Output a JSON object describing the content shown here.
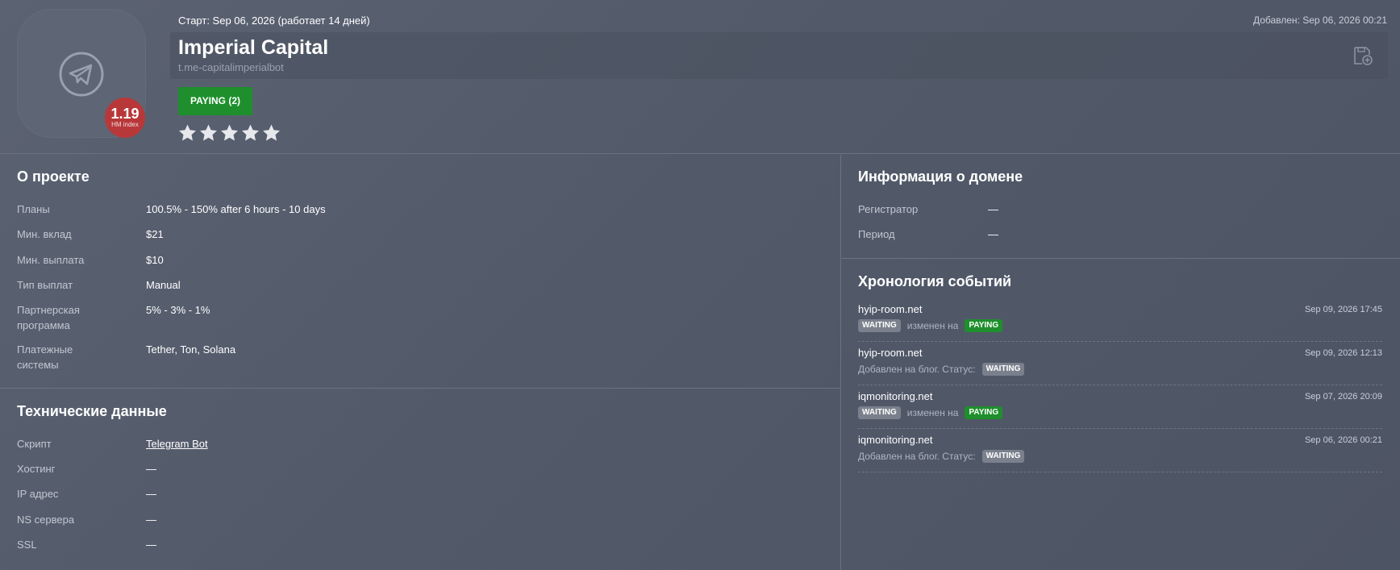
{
  "header": {
    "start_text": "Старт: Sep 06, 2026 (работает 14 дней)",
    "added_text": "Добавлен: Sep 06, 2026 00:21",
    "title": "Imperial Capital",
    "url": "t.me-capitalimperialbot",
    "status_label": "PAYING (2)",
    "hm_index_value": "1.19",
    "hm_index_label": "HM index",
    "rating_stars": 5,
    "icons": {
      "logo": "telegram-icon",
      "bookmark": "bookmark-add-icon",
      "star": "star-icon"
    }
  },
  "about": {
    "title": "О проекте",
    "rows": [
      {
        "key": "Планы",
        "value": "100.5% - 150% after 6 hours - 10 days"
      },
      {
        "key": "Мин. вклад",
        "value": "$21"
      },
      {
        "key": "Мин. выплата",
        "value": "$10"
      },
      {
        "key": "Тип выплат",
        "value": "Manual"
      },
      {
        "key": "Партнерская программа",
        "value": "5% - 3% - 1%"
      },
      {
        "key": "Платежные системы",
        "value": "Tether, Ton, Solana"
      }
    ]
  },
  "tech": {
    "title": "Технические данные",
    "rows": [
      {
        "key": "Скрипт",
        "value": "Telegram Bot"
      },
      {
        "key": "Хостинг",
        "value": "—"
      },
      {
        "key": "IP адрес",
        "value": "—"
      },
      {
        "key": "NS сервера",
        "value": "—"
      },
      {
        "key": "SSL",
        "value": "—"
      }
    ]
  },
  "domain": {
    "title": "Информация о домене",
    "rows": [
      {
        "key": "Регистратор",
        "value": "—"
      },
      {
        "key": "Период",
        "value": "—"
      }
    ]
  },
  "timeline": {
    "title": "Хронология событий",
    "events": [
      {
        "site": "hyip-room.net",
        "date": "Sep 09, 2026 17:45",
        "from": "WAITING",
        "text": "изменен на",
        "to": "PAYING"
      },
      {
        "site": "hyip-room.net",
        "date": "Sep 09, 2026 12:13",
        "text": "Добавлен на блог. Статус:",
        "to": "WAITING"
      },
      {
        "site": "iqmonitoring.net",
        "date": "Sep 07, 2026 20:09",
        "from": "WAITING",
        "text": "изменен на",
        "to": "PAYING"
      },
      {
        "site": "iqmonitoring.net",
        "date": "Sep 06, 2026 00:21",
        "text": "Добавлен на блог. Статус:",
        "to": "WAITING"
      }
    ]
  },
  "colors": {
    "paying": "#1e8f2c",
    "waiting": "#7a808c",
    "hm_badge": "#b8383a",
    "background": "#545b6b"
  }
}
